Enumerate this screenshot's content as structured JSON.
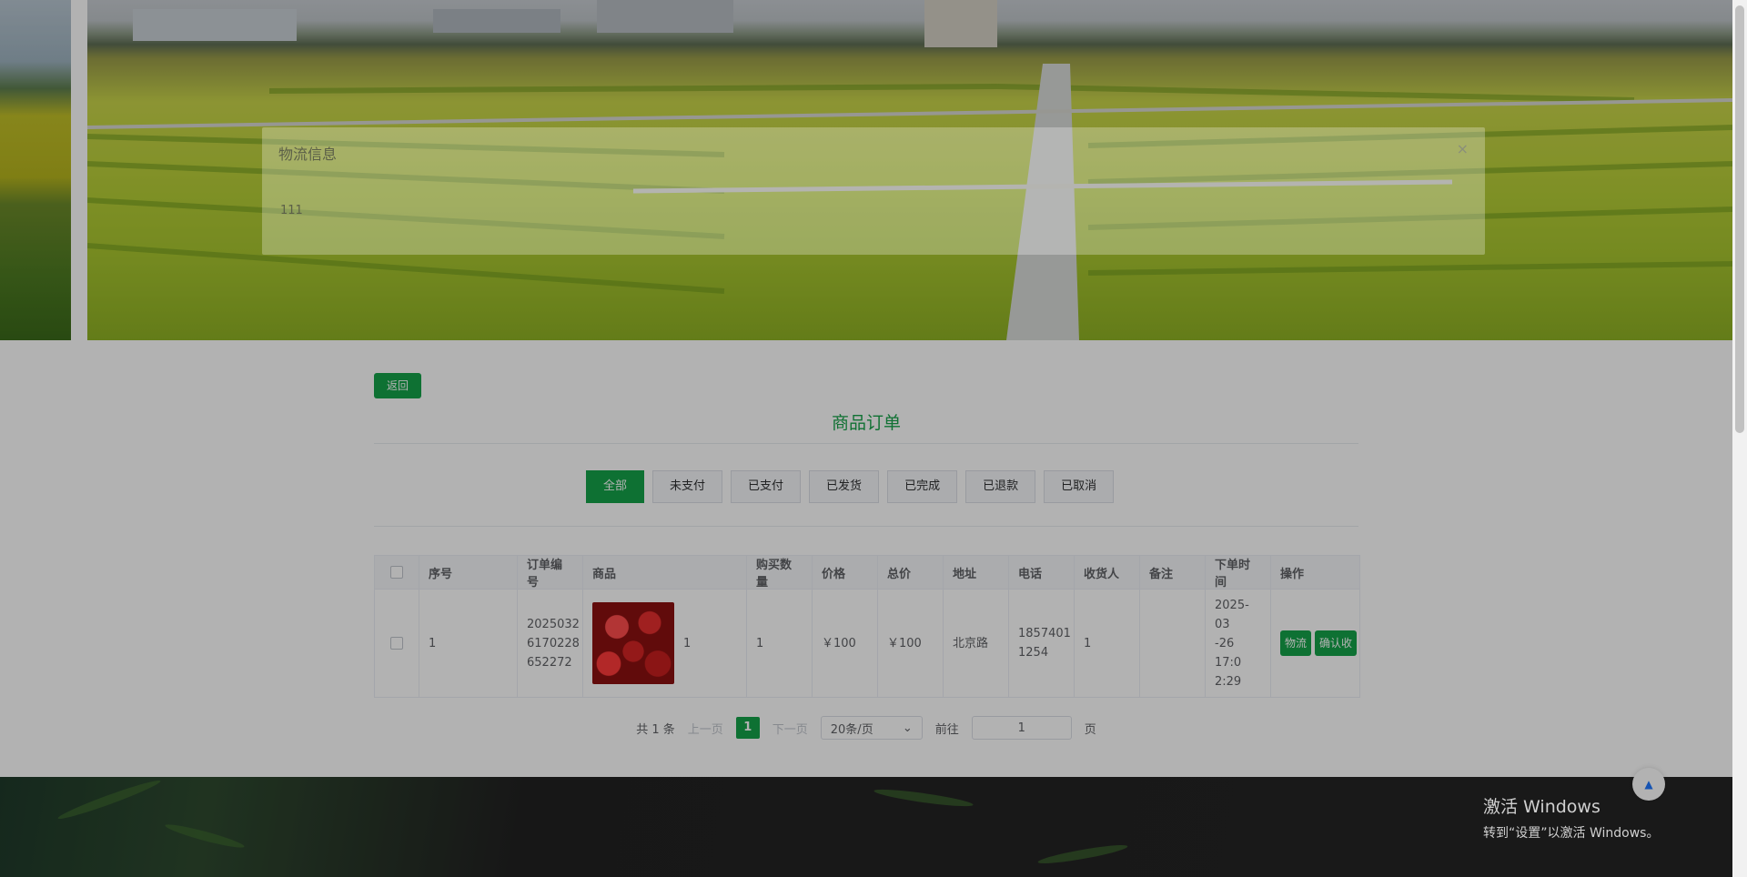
{
  "dialog": {
    "title": "物流信息",
    "close_icon": "×",
    "body": "111"
  },
  "page": {
    "back_label": "返回",
    "title": "商品订单"
  },
  "tabs": [
    "全部",
    "未支付",
    "已支付",
    "已发货",
    "已完成",
    "已退款",
    "已取消"
  ],
  "table": {
    "headers": [
      "序号",
      "订单编号",
      "商品",
      "购买数量",
      "价格",
      "总价",
      "地址",
      "电话",
      "收货人",
      "备注",
      "下单时间",
      "操作"
    ],
    "rows": [
      {
        "index": "1",
        "order_no": "2025032617022 8652272",
        "order_no_display": "2025032\n6170228\n652272",
        "goods_count": "1",
        "quantity": "1",
        "price": "￥100",
        "total": "￥100",
        "address": "北京路",
        "phone": "1857401\n1254",
        "receiver": "1",
        "note": "",
        "time": "2025-03\n-26 17:0\n2:29",
        "actions": {
          "logistics": "物流",
          "confirm": "确认收"
        }
      }
    ]
  },
  "pager": {
    "total": "共 1 条",
    "prev": "上一页",
    "current": "1",
    "next": "下一页",
    "page_size": "20条/页",
    "goto_label": "前往",
    "goto_value": "1",
    "page_unit": "页"
  },
  "footer": {
    "activate_title": "激活 Windows",
    "activate_hint": "转到“设置”以激活 Windows。"
  },
  "colors": {
    "accent": "#15a34a",
    "title": "#17a34a"
  }
}
